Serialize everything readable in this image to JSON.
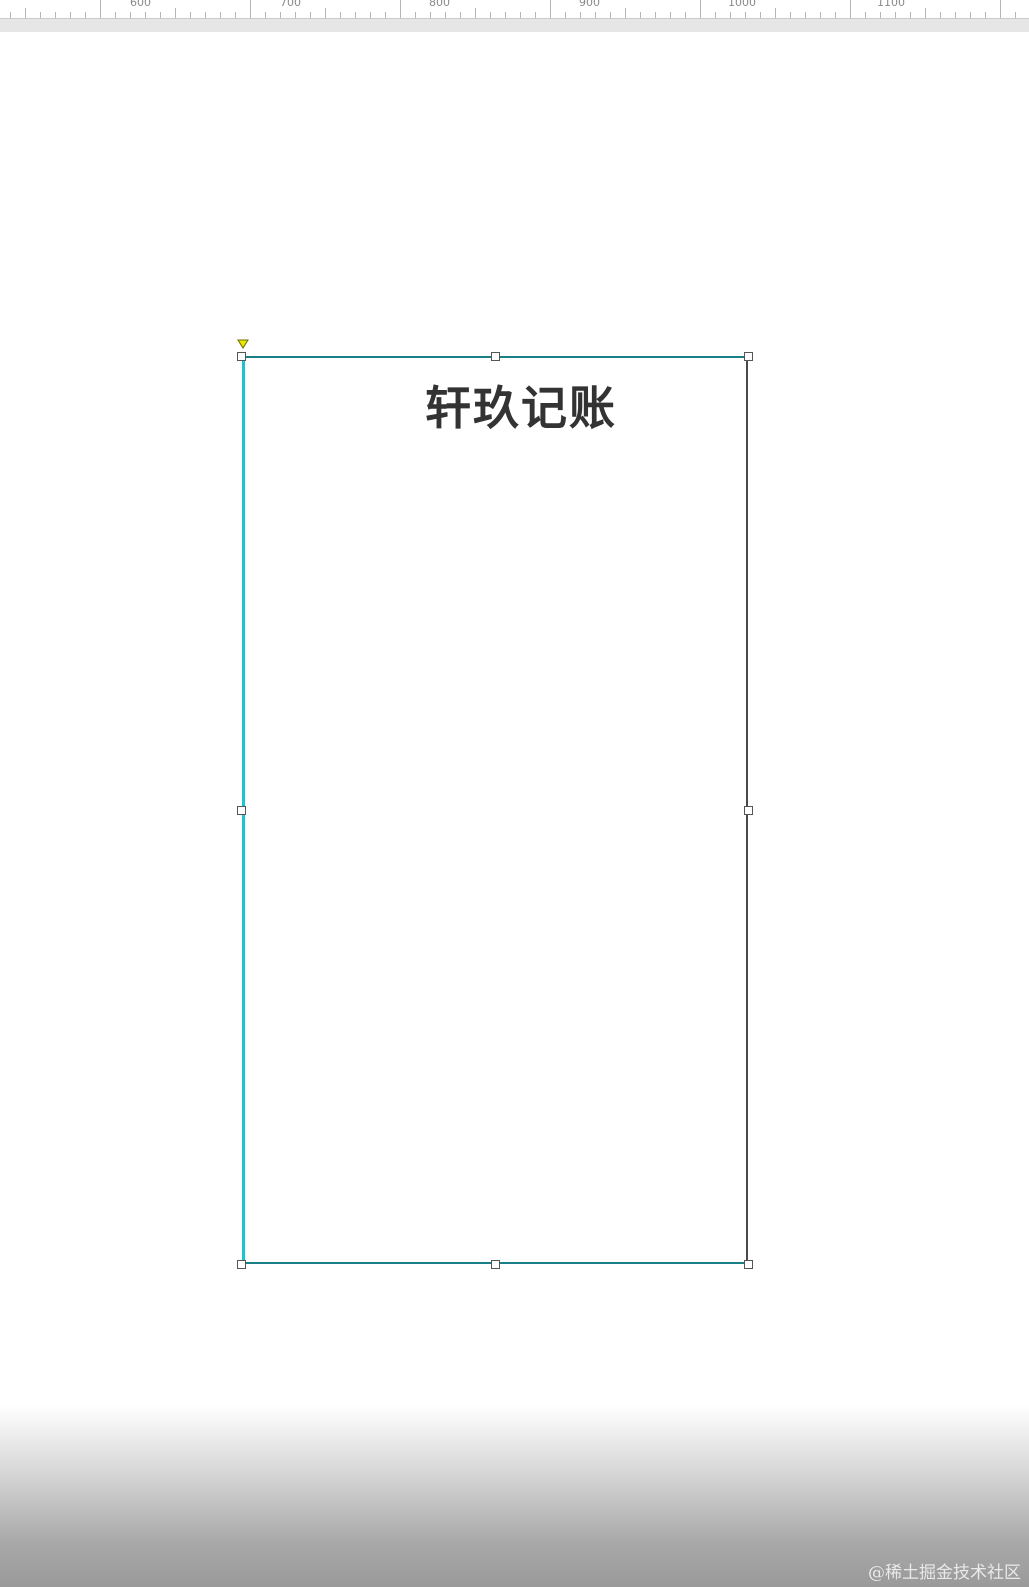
{
  "ruler": {
    "labels": [
      "600",
      "700",
      "800",
      "900",
      "1000",
      "1100"
    ]
  },
  "canvas": {
    "title": "轩玖记账"
  },
  "colors": {
    "frame_left": "#19c6cf",
    "frame_edge": "#1a7f86",
    "frame_right": "#4a4a4a",
    "title": "#333333",
    "anchor": "#e8e800"
  },
  "icons": {
    "anchor": "anchor-triangle-icon",
    "handle": "resize-handle-icon"
  },
  "watermark": "@稀土掘金技术社区"
}
